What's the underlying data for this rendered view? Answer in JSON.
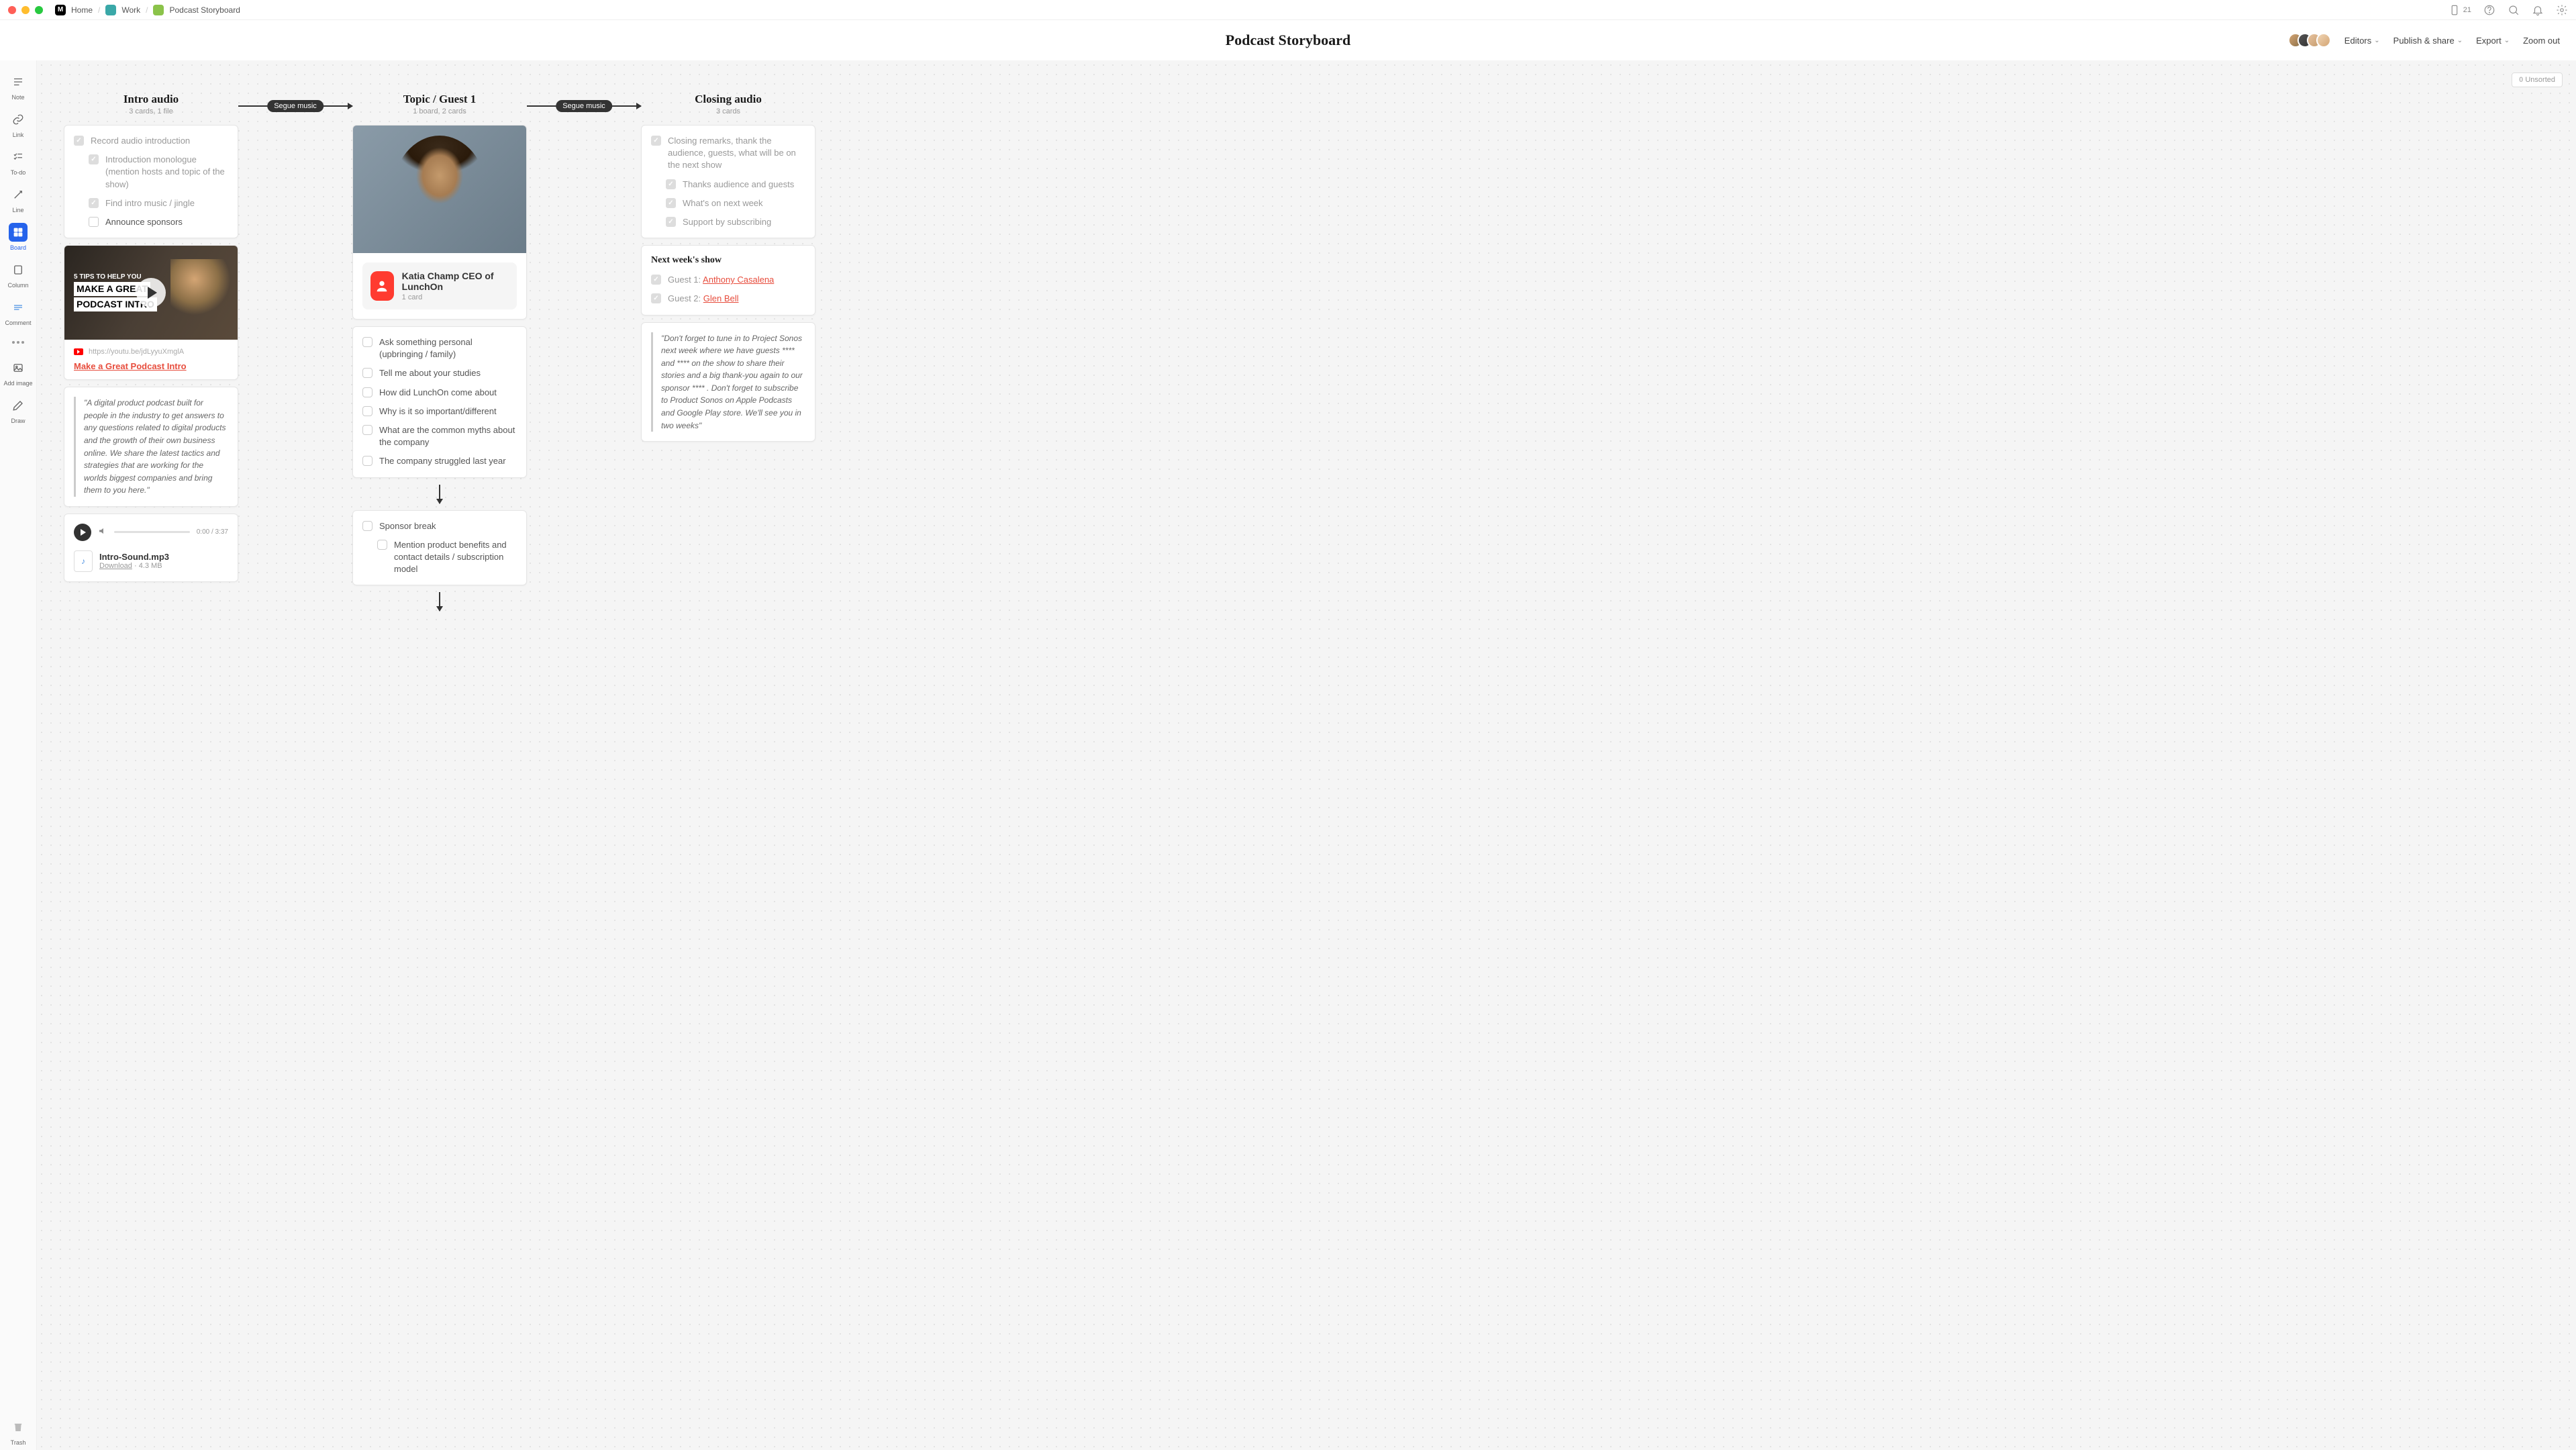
{
  "titlebar": {
    "breadcrumbs": {
      "home": "Home",
      "work": "Work",
      "doc": "Podcast Storyboard"
    },
    "device_count": "21"
  },
  "header": {
    "title": "Podcast Storyboard",
    "editors": "Editors",
    "publish": "Publish & share",
    "export": "Export",
    "zoom_out": "Zoom out"
  },
  "sidebar": {
    "note": "Note",
    "link": "Link",
    "todo": "To-do",
    "line": "Line",
    "board": "Board",
    "column": "Column",
    "comment": "Comment",
    "add_image": "Add image",
    "draw": "Draw",
    "trash": "Trash"
  },
  "canvas": {
    "unsorted_count": "0",
    "unsorted_label": "Unsorted",
    "segue_label": "Segue music"
  },
  "col1": {
    "title": "Intro audio",
    "meta": "3 cards, 1 file",
    "checks": {
      "c1": "Record audio introduction",
      "c2": "Introduction monologue (mention hosts and topic of the show)",
      "c3": "Find intro music / jingle",
      "c4": "Announce sponsors"
    },
    "video": {
      "tip_line": "5 TIPS TO HELP YOU",
      "big1": "MAKE A GREAT",
      "big2": "PODCAST INTRO",
      "url": "https://youtu.be/jdLyyuXmglA",
      "link_text": "Make a Great Podcast Intro"
    },
    "quote": "\"A digital product podcast built for people in the industry to get answers to any questions related to digital products and the growth of their own business online. We share the latest tactics and strategies that are working for the worlds biggest companies and bring them to you here.\"",
    "audio": {
      "time": "0:00 / 3:37",
      "filename": "Intro-Sound.mp3",
      "download": "Download",
      "size": "4.3 MB"
    }
  },
  "col2": {
    "title": "Topic / Guest 1",
    "meta": "1 board, 2 cards",
    "guest": {
      "name": "Katia Champ CEO of LunchOn",
      "sub": "1 card"
    },
    "questions": {
      "q1": "Ask something personal (upbringing / family)",
      "q2": "Tell me about your studies",
      "q3": "How did LunchOn come about",
      "q4": "Why is it so important/different",
      "q5": "What are the common myths about the company",
      "q6": "The company struggled last year"
    },
    "sponsor": {
      "s1": "Sponsor break",
      "s2": "Mention product benefits and contact details / subscription model"
    }
  },
  "col3": {
    "title": "Closing audio",
    "meta": "3 cards",
    "checks": {
      "c1": "Closing remarks, thank the audience, guests, what will be on the next show",
      "c2": "Thanks audience and guests",
      "c3": "What's on next week",
      "c4": "Support by subscribing"
    },
    "next_show": {
      "title": "Next week's show",
      "g1_label": "Guest 1: ",
      "g1_name": "Anthony Casalena",
      "g2_label": "Guest 2: ",
      "g2_name": "Glen Bell"
    },
    "quote": "\"Don't forget to tune in to Project Sonos next week where we have guests **** and **** on the show to share their stories and a big thank-you again to our sponsor **** . Don't forget to subscribe to Product Sonos on Apple Podcasts and Google Play store. We'll see you in two weeks\""
  }
}
